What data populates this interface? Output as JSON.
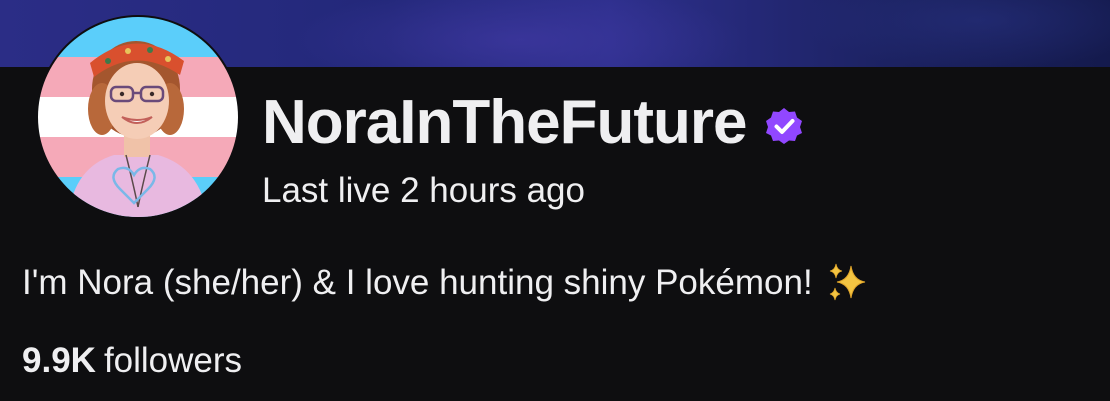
{
  "channel": {
    "name": "NoraInTheFuture",
    "verified_icon": "verified-badge-icon",
    "last_live": "Last live 2 hours ago",
    "bio": "I'm Nora (she/her) & I love hunting shiny Pokémon!",
    "bio_emoji_icon": "sparkles-icon",
    "followers_count": "9.9K",
    "followers_label": "followers"
  },
  "colors": {
    "background": "#0e0e10",
    "text": "#efeff1",
    "verified_purple": "#9147ff",
    "banner": "#2b2d86",
    "trans_blue": "#5bcefa",
    "trans_pink": "#f5a9b8",
    "sparkle_gold": "#f4c542"
  }
}
